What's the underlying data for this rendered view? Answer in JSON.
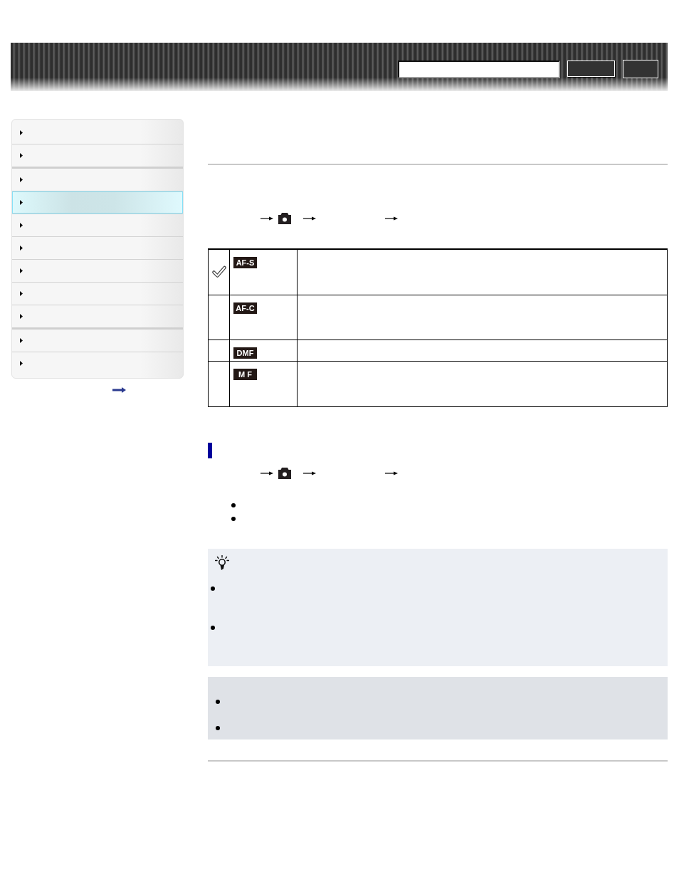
{
  "sidebar": {
    "items": [
      {
        "selected": false
      },
      {
        "selected": false
      },
      {
        "selected": false
      },
      {
        "selected": true
      },
      {
        "selected": false
      },
      {
        "selected": false
      },
      {
        "selected": false
      },
      {
        "selected": false
      },
      {
        "selected": false
      },
      {
        "selected": false
      },
      {
        "selected": false
      }
    ]
  },
  "settings_table": {
    "rows": [
      {
        "badge": "AF-S",
        "checked": true
      },
      {
        "badge": "AF-C",
        "checked": false
      },
      {
        "badge": "DMF",
        "checked": false
      },
      {
        "badge": "M F",
        "checked": false
      }
    ]
  }
}
